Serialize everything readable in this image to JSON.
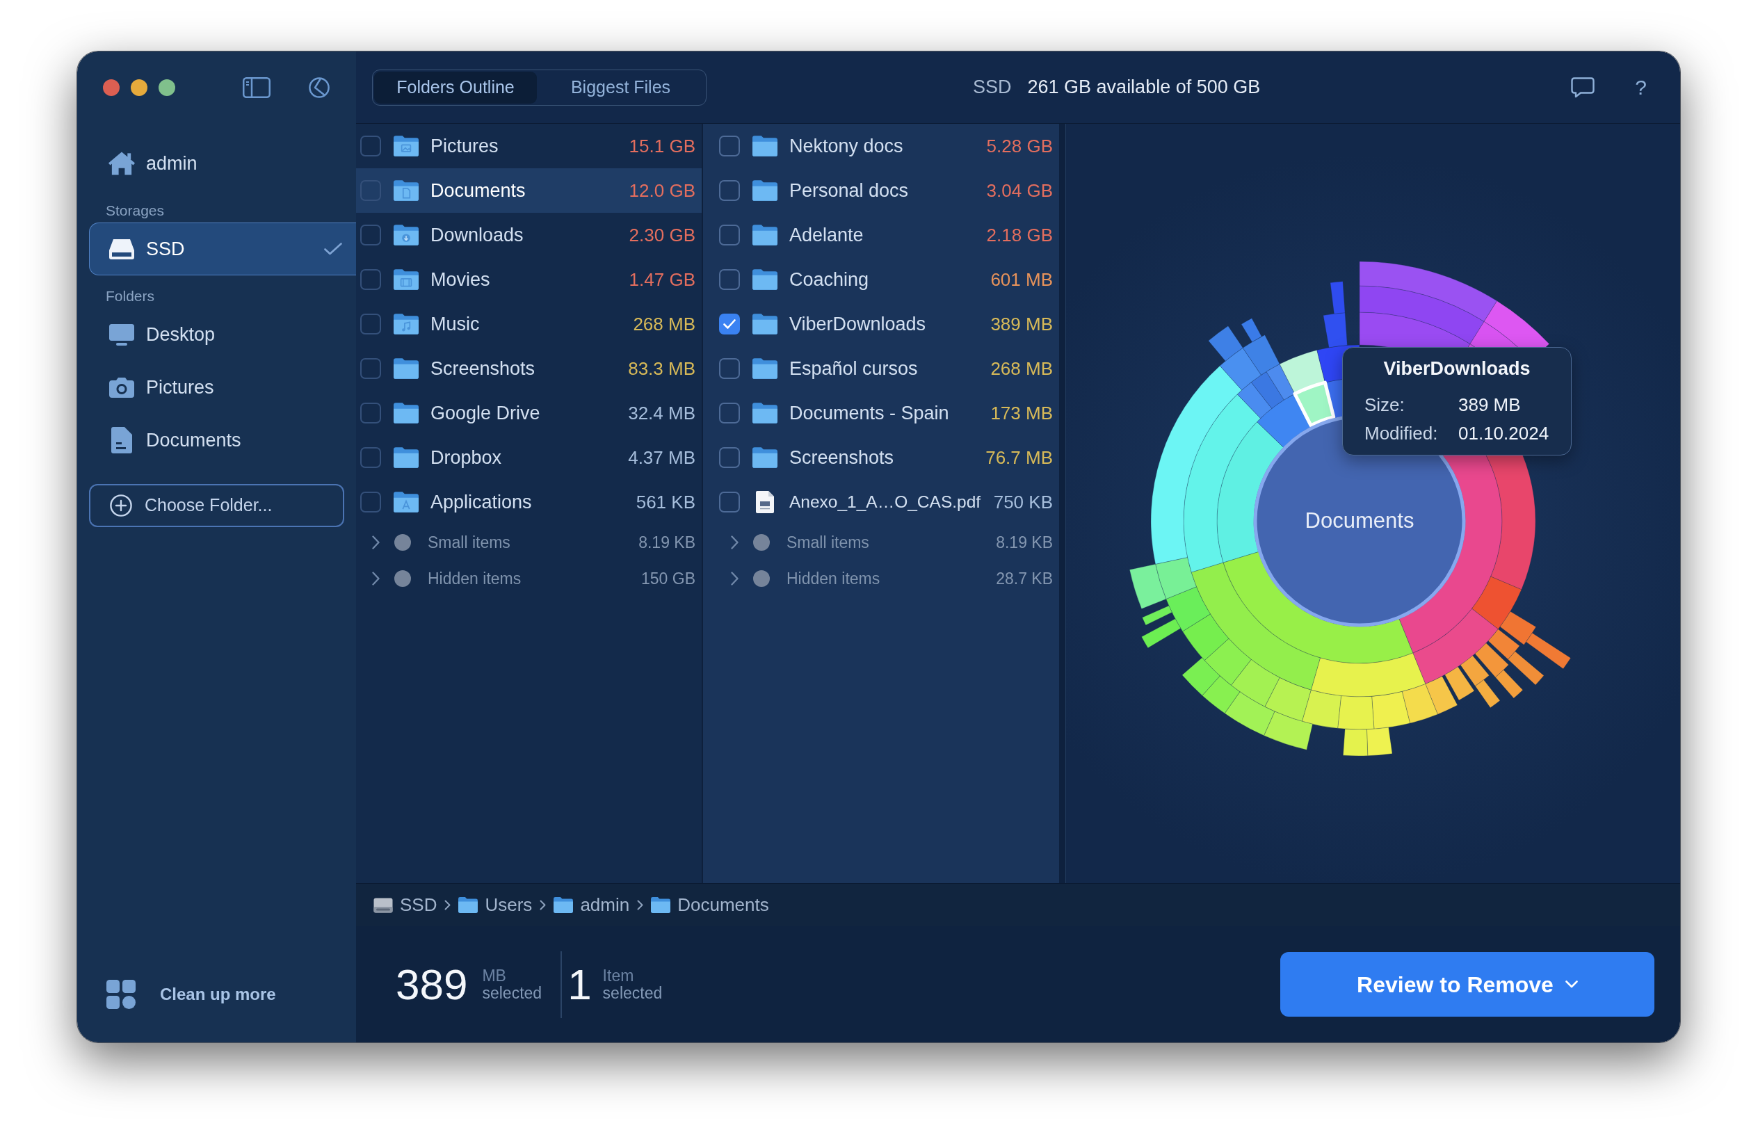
{
  "sidebar": {
    "home": {
      "label": "admin",
      "kind": "home",
      "selected": false
    },
    "sections": [
      {
        "heading": "Storages",
        "items": [
          {
            "label": "SSD",
            "kind": "drive",
            "selected": true
          }
        ]
      },
      {
        "heading": "Folders",
        "items": [
          {
            "label": "Desktop",
            "kind": "desktop",
            "selected": false
          },
          {
            "label": "Pictures",
            "kind": "camera",
            "selected": false
          },
          {
            "label": "Documents",
            "kind": "document",
            "selected": false
          }
        ]
      }
    ],
    "choose_folder_button": "Choose Folder...",
    "clean_up_button": "Clean up more"
  },
  "toolbar": {
    "tabs": [
      {
        "label": "Folders Outline",
        "selected": true
      },
      {
        "label": "Biggest Files",
        "selected": false
      }
    ],
    "disk_name": "SSD",
    "disk_space": "261 GB available of 500 GB",
    "help_button": "?"
  },
  "columns": [
    {
      "rows": [
        {
          "name": "Pictures",
          "size": "15.1 GB",
          "color": "#e46e5e",
          "kind": "pictures",
          "checked": false,
          "selected": false
        },
        {
          "name": "Documents",
          "size": "12.0 GB",
          "color": "#e46e5e",
          "kind": "documents",
          "checked": false,
          "selected": true
        },
        {
          "name": "Downloads",
          "size": "2.30 GB",
          "color": "#e46e5e",
          "kind": "downloads",
          "checked": false,
          "selected": false
        },
        {
          "name": "Movies",
          "size": "1.47 GB",
          "color": "#e46e5e",
          "kind": "movies",
          "checked": false,
          "selected": false
        },
        {
          "name": "Music",
          "size": "268 MB",
          "color": "#d8ba58",
          "kind": "music",
          "checked": false,
          "selected": false
        },
        {
          "name": "Screenshots",
          "size": "83.3 MB",
          "color": "#d8ba58",
          "kind": "folder",
          "checked": false,
          "selected": false
        },
        {
          "name": "Google Drive",
          "size": "32.4 MB",
          "color": "#a6bedc",
          "kind": "folder",
          "checked": false,
          "selected": false
        },
        {
          "name": "Dropbox",
          "size": "4.37 MB",
          "color": "#a6bedc",
          "kind": "folder",
          "checked": false,
          "selected": false
        },
        {
          "name": "Applications",
          "size": "561 KB",
          "color": "#a6bedc",
          "kind": "applications",
          "checked": false,
          "selected": false
        }
      ],
      "summary_rows": [
        {
          "label": "Small items",
          "size": "8.19 KB",
          "expanded": false
        },
        {
          "label": "Hidden items",
          "size": "150 GB",
          "expanded": false
        }
      ]
    },
    {
      "rows": [
        {
          "name": "Nektony docs",
          "size": "5.28 GB",
          "color": "#e46e5e",
          "kind": "folder",
          "checked": false,
          "selected": false
        },
        {
          "name": "Personal docs",
          "size": "3.04 GB",
          "color": "#e46e5e",
          "kind": "folder",
          "checked": false,
          "selected": false
        },
        {
          "name": "Adelante",
          "size": "2.18 GB",
          "color": "#e46e5e",
          "kind": "folder",
          "checked": false,
          "selected": false
        },
        {
          "name": "Coaching",
          "size": "601 MB",
          "color": "#e8935a",
          "kind": "folder",
          "checked": false,
          "selected": false
        },
        {
          "name": "ViberDownloads",
          "size": "389 MB",
          "color": "#d8ba58",
          "kind": "folder",
          "checked": true,
          "selected": false
        },
        {
          "name": "Español cursos",
          "size": "268 MB",
          "color": "#d8ba58",
          "kind": "folder",
          "checked": false,
          "selected": false
        },
        {
          "name": "Documents - Spain",
          "size": "173 MB",
          "color": "#d8ba58",
          "kind": "folder",
          "checked": false,
          "selected": false
        },
        {
          "name": "Screenshots",
          "size": "76.7 MB",
          "color": "#d8ba58",
          "kind": "folder",
          "checked": false,
          "selected": false
        },
        {
          "name": "Anexo_1_A…O_CAS.pdf",
          "size": "750 KB",
          "color": "#a6bedc",
          "kind": "file",
          "checked": false,
          "selected": false
        }
      ],
      "summary_rows": [
        {
          "label": "Small items",
          "size": "8.19 KB",
          "expanded": false
        },
        {
          "label": "Hidden items",
          "size": "28.7 KB",
          "expanded": false
        }
      ]
    }
  ],
  "breadcrumb": [
    {
      "label": "SSD",
      "kind": "drive"
    },
    {
      "label": "Users",
      "kind": "folder"
    },
    {
      "label": "admin",
      "kind": "folder"
    },
    {
      "label": "Documents",
      "kind": "folder"
    }
  ],
  "selection_summary": {
    "size_value": "389",
    "size_unit": "MB",
    "size_caption": "selected",
    "count_value": "1",
    "count_unit": "Item",
    "count_caption": "selected"
  },
  "review_button": {
    "label": "Review to Remove"
  },
  "chart": {
    "center_label": "Documents",
    "tooltip": {
      "title": "ViberDownloads",
      "fields": [
        {
          "label": "Size:",
          "value": "389 MB"
        },
        {
          "label": "Modified:",
          "value": "01.10.2024"
        }
      ]
    }
  }
}
